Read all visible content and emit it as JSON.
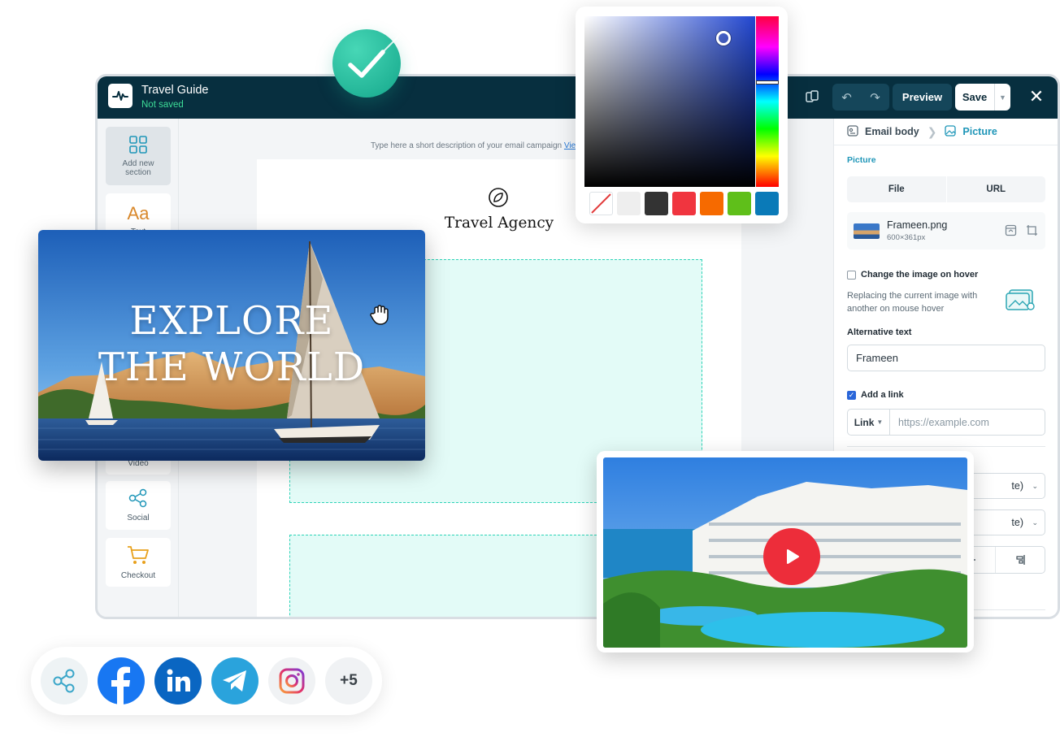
{
  "header": {
    "title": "Travel Guide",
    "status": "Not saved",
    "preview_label": "Preview",
    "save_label": "Save"
  },
  "sidebar": {
    "items": [
      {
        "label": "Add new section"
      },
      {
        "label": "Text"
      },
      {
        "label": "Video"
      },
      {
        "label": "Social"
      },
      {
        "label": "Checkout"
      }
    ]
  },
  "canvas": {
    "preheader": "Type here a short description of your email campaign",
    "preheader_link": "View",
    "brand_name": "Travel Agency"
  },
  "panel": {
    "breadcrumb": [
      "Email body",
      "Picture"
    ],
    "section_title": "Picture",
    "source_tabs": [
      "File",
      "URL"
    ],
    "file": {
      "name": "Frameen.png",
      "size": "600×361px"
    },
    "hover_label": "Change the image on hover",
    "hover_checked": false,
    "hover_hint": "Replacing the current image with another on mouse hover",
    "alt_label": "Alternative text",
    "alt_value": "Frameen",
    "link_label": "Add a link",
    "link_checked": true,
    "link_type": "Link",
    "link_placeholder": "https://example.com",
    "select_1_value": "te)",
    "select_2_value": "te)"
  },
  "color_picker": {
    "swatches": [
      "none",
      "#eeeeee",
      "#333333",
      "#f0353f",
      "#f66a00",
      "#5fbf1a",
      "#0a7ab8"
    ]
  },
  "hero": {
    "title_line1": "EXPLORE",
    "title_line2": "THE WORLD"
  },
  "share_bar": {
    "networks": [
      "share-icon",
      "facebook-icon",
      "linkedin-icon",
      "telegram-icon",
      "instagram-icon"
    ],
    "more_label": "+5"
  },
  "colors": {
    "topbar": "#072f3f",
    "accent": "#1f96b8",
    "status_ok": "#3ddc97",
    "dashed_outline": "#2ed3b7",
    "play_button": "#ed2d3a"
  }
}
